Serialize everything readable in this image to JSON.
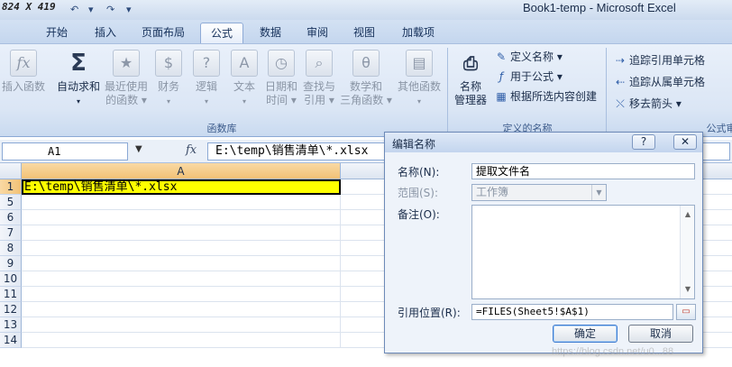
{
  "titlebar": {
    "dimension_tag": "824 X 419",
    "title": "Book1-temp - Microsoft Excel",
    "qat_undo": "↶",
    "qat_redo": "↷",
    "qat_more": "▾"
  },
  "tabs": [
    "开始",
    "插入",
    "页面布局",
    "公式",
    "数据",
    "审阅",
    "视图",
    "加载项"
  ],
  "active_tab": "公式",
  "ribbon": {
    "function_library": {
      "label": "函数库",
      "buttons": [
        {
          "line1": "插入函数",
          "line2": "",
          "icon": "fx"
        },
        {
          "line1": "自动求和",
          "line2": "▾",
          "icon": "Σ"
        },
        {
          "line1": "最近使用",
          "line2": "的函数 ▾",
          "icon": "★"
        },
        {
          "line1": "财务",
          "line2": "▾",
          "icon": "$"
        },
        {
          "line1": "逻辑",
          "line2": "▾",
          "icon": "?"
        },
        {
          "line1": "文本",
          "line2": "▾",
          "icon": "A"
        },
        {
          "line1": "日期和",
          "line2": "时间 ▾",
          "icon": "◷"
        },
        {
          "line1": "查找与",
          "line2": "引用 ▾",
          "icon": "⌕"
        },
        {
          "line1": "数学和",
          "line2": "三角函数 ▾",
          "icon": "θ"
        },
        {
          "line1": "其他函数",
          "line2": "▾",
          "icon": "▤"
        }
      ]
    },
    "defined_names": {
      "label": "定义的名称",
      "name_manager": {
        "line1": "名称",
        "line2": "管理器"
      },
      "define_name": "定义名称 ▾",
      "use_in_formula": "用于公式 ▾",
      "create_from_selection": "根据所选内容创建"
    },
    "formula_auditing": {
      "label": "公式审",
      "trace_precedents": "追踪引用单元格",
      "trace_dependents": "追踪从属单元格",
      "remove_arrows": "移去箭头 ▾"
    }
  },
  "formula_bar": {
    "name_box": "A1",
    "fx": "fx",
    "formula": "E:\\temp\\销售清单\\*.xlsx"
  },
  "sheet": {
    "column_a": "A",
    "rows": [
      "1",
      "5",
      "6",
      "7",
      "8",
      "9",
      "10",
      "11",
      "12",
      "13",
      "14"
    ],
    "a1_value": "E:\\temp\\销售清单\\*.xlsx"
  },
  "dialog": {
    "title": "编辑名称",
    "help": "?",
    "close": "✕",
    "name_label": "名称(N):",
    "name_value": "提取文件名",
    "scope_label": "范围(S):",
    "scope_value": "工作簿",
    "comment_label": "备注(O):",
    "comment_value": "",
    "refers_label": "引用位置(R):",
    "refers_value": "=FILES(Sheet5!$A$1)",
    "ok": "确定",
    "cancel": "取消"
  },
  "watermark": "https://blog.csdn.net/u0...88"
}
